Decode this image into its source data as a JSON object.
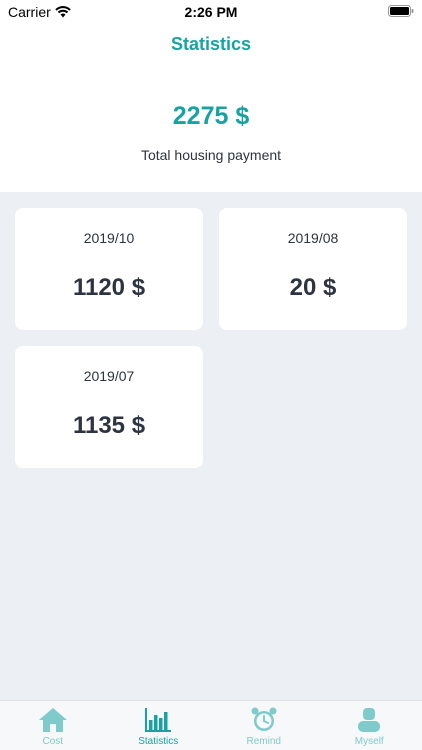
{
  "status_bar": {
    "carrier": "Carrier",
    "time": "2:26 PM"
  },
  "nav": {
    "title": "Statistics"
  },
  "summary": {
    "amount": "2275 $",
    "label": "Total housing payment"
  },
  "cards": [
    {
      "month": "2019/10",
      "amount": "1120 $"
    },
    {
      "month": "2019/08",
      "amount": "20 $"
    },
    {
      "month": "2019/07",
      "amount": "1135 $"
    }
  ],
  "tabbar": {
    "items": [
      {
        "label": "Cost",
        "icon": "house-icon"
      },
      {
        "label": "Statistics",
        "icon": "bar-chart-icon",
        "active": true
      },
      {
        "label": "Remind",
        "icon": "alarm-clock-icon"
      },
      {
        "label": "Myself",
        "icon": "person-icon"
      }
    ]
  },
  "colors": {
    "accent": "#17a3a3",
    "background": "#eceff4",
    "text": "#2d3340"
  }
}
